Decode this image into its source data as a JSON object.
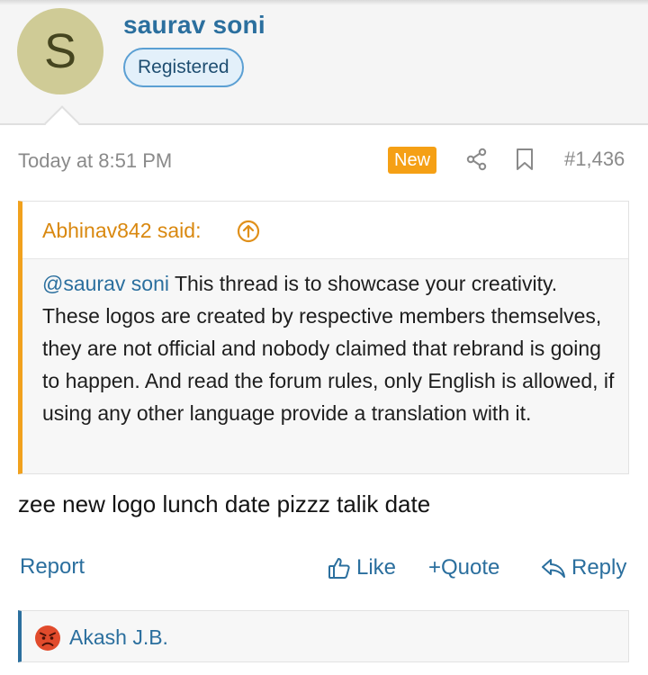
{
  "user": {
    "avatar_letter": "S",
    "name": "saurav soni",
    "badge": "Registered"
  },
  "post": {
    "date": "Today at 8:51 PM",
    "new_label": "New",
    "number": "#1,436",
    "message": "zee new logo lunch date pizzz talik date"
  },
  "quote": {
    "author_label": "Abhinav842 said:",
    "mention": "@saurav soni",
    "body": " This thread is to showcase your creativity. These logos are created by respective members themselves, they are not official and nobody claimed that rebrand is going to happen. And read the forum rules, only English is allowed, if using any other language provide a translation with it."
  },
  "actions": {
    "report": "Report",
    "like": "Like",
    "quote": "+Quote",
    "reply": "Reply"
  },
  "reactions": {
    "user": "Akash J.B."
  },
  "icons": {
    "share": "share-icon",
    "bookmark": "bookmark-icon",
    "quote_jump": "arrow-up-circle-icon",
    "like": "thumbs-up-icon",
    "reply": "reply-arrow-icon",
    "reaction": "angry-face-icon"
  },
  "colors": {
    "link": "#2b6f9e",
    "accent": "#f1a11d",
    "new_badge": "#f5a015",
    "avatar_bg": "#cfcb96"
  }
}
